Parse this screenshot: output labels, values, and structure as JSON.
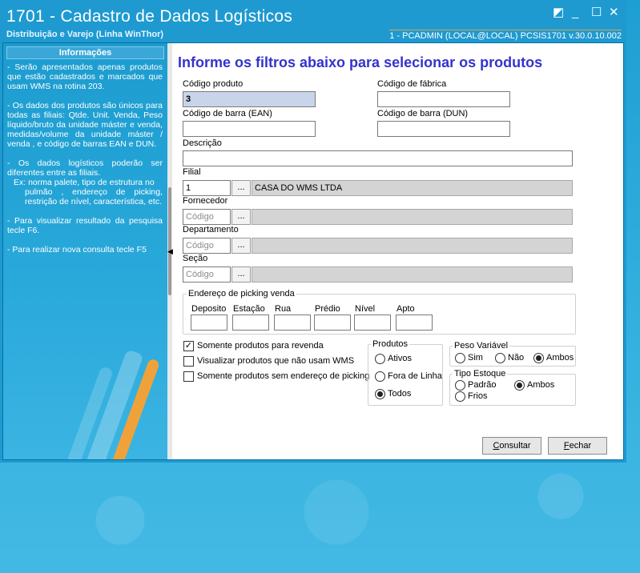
{
  "window": {
    "title": "1701 - Cadastro de Dados Logísticos",
    "subtitle": "Distribuição e Varejo (Linha WinThor)",
    "user_info": "1 - PCADMIN (LOCAL@LOCAL)   PCSIS1701  v.30.0.10.002"
  },
  "sidebar": {
    "header": "Informações",
    "p1": "- Serão apresentados apenas produtos que estão cadastrados e marcados que usam WMS na rotina 203.",
    "p2": "- Os dados dos produtos são únicos para todas as filiais: Qtde. Unit. Venda, Peso líquido/bruto da unidade máster e venda, medidas/volume da unidade máster / venda , e código de barras EAN e DUN.",
    "p3": "- Os dados logísticos poderão ser diferentes entre as filiais.",
    "p3_ex": "Ex: norma palete, tipo de estrutura no",
    "p3_ex2": "pulmão , endereço de picking, restrição de nível, característica, etc.",
    "p4": "- Para visualizar resultado da pesquisa tecle F6.",
    "p5": "- Para realizar nova consulta tecle F5"
  },
  "main": {
    "heading": "Informe os filtros abaixo para selecionar os produtos",
    "codigo_produto": {
      "label": "Código produto",
      "value": "3"
    },
    "codigo_fabrica": {
      "label": "Código de fábrica",
      "value": ""
    },
    "codigo_ean": {
      "label": "Código de barra (EAN)",
      "value": ""
    },
    "codigo_dun": {
      "label": "Código de barra (DUN)",
      "value": ""
    },
    "descricao": {
      "label": "Descrição",
      "value": ""
    },
    "filial": {
      "label": "Filial",
      "value": "1",
      "name": "CASA DO WMS LTDA"
    },
    "fornecedor": {
      "label": "Fornecedor",
      "placeholder": "Código"
    },
    "departamento": {
      "label": "Departamento",
      "placeholder": "Código"
    },
    "secao": {
      "label": "Seção",
      "placeholder": "Código"
    },
    "lookup_button": "...",
    "picking": {
      "title": "Endereço de picking venda",
      "deposito": "Deposito",
      "estacao": "Estação",
      "rua": "Rua",
      "predio": "Prédio",
      "nivel": "Nível",
      "apto": "Apto"
    },
    "check_revenda": {
      "label": "Somente produtos para revenda",
      "checked": true,
      "mark": "✓"
    },
    "check_nao_wms": {
      "label": "Visualizar produtos que não usam WMS",
      "checked": false
    },
    "check_sem_endereco": {
      "label": "Somente produtos sem endereço de picking",
      "checked": false
    },
    "produtos": {
      "title": "Produtos",
      "ativos": "Ativos",
      "fora_linha": "Fora de Linha",
      "todos": "Todos",
      "selected": "Todos"
    },
    "peso_variavel": {
      "title": "Peso Variável",
      "sim": "Sim",
      "nao": "Não",
      "ambos": "Ambos",
      "selected": "Ambos"
    },
    "tipo_estoque": {
      "title": "Tipo Estoque",
      "padrao": "Padrão",
      "ambos": "Ambos",
      "frios": "Frios",
      "selected": "Ambos"
    },
    "consultar_pre": "C",
    "consultar_rest": "onsultar",
    "fechar_pre": "F",
    "fechar_rest": "echar"
  },
  "colors": {
    "accent": "#3333cc",
    "sidebar": "#1e9ad1",
    "stripe_orange": "#f0a23a"
  }
}
